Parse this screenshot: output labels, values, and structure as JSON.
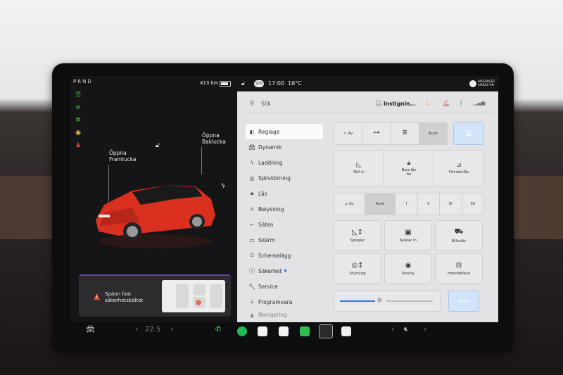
{
  "left": {
    "gear": "PRND",
    "range": "413 km",
    "callout_front": {
      "line1": "Öppna",
      "line2": "Framlucka"
    },
    "callout_rear": {
      "line1": "Öppna",
      "line2": "Baklucka"
    },
    "alert": {
      "line1": "Spänn fast",
      "line2": "säkerhetsbältet"
    }
  },
  "topbar": {
    "time": "17:00",
    "temp": "16°C",
    "sos": "SOS",
    "passenger_airbag_1": "PASSENGER",
    "passenger_airbag_2": "AIRBAG ON"
  },
  "search": {
    "label": "Sök",
    "profile": "Instignin..."
  },
  "menu": [
    {
      "label": "Reglage",
      "icon": "toggle-icon"
    },
    {
      "label": "Dynamik",
      "icon": "car-icon"
    },
    {
      "label": "Laddning",
      "icon": "bolt-icon"
    },
    {
      "label": "Självkörning",
      "icon": "steering-wheel-icon"
    },
    {
      "label": "Lås",
      "icon": "lock-icon"
    },
    {
      "label": "Belysning",
      "icon": "sun-icon"
    },
    {
      "label": "Säten",
      "icon": "seat-icon"
    },
    {
      "label": "Skärm",
      "icon": "screen-icon"
    },
    {
      "label": "Schemalägg",
      "icon": "schedule-icon"
    },
    {
      "label": "Säkerhet",
      "icon": "info-icon"
    },
    {
      "label": "Service",
      "icon": "wrench-icon"
    },
    {
      "label": "Programvara",
      "icon": "download-icon"
    },
    {
      "label": "Navigering",
      "icon": "navigation-icon"
    }
  ],
  "lights": {
    "off": "Av",
    "auto": "Auto"
  },
  "locks": {
    "fold": "Fäll in",
    "child_lock_1": "Barnlås",
    "child_lock_2": "Av",
    "windows": "Fönsterlås"
  },
  "wipers": {
    "off": "Av",
    "auto": "Auto",
    "s1": "I",
    "s2": "II",
    "s3": "III",
    "s4": "IIII"
  },
  "grid": [
    {
      "label": "Speglar",
      "icon": "mirror-icon"
    },
    {
      "label": "Spelar in",
      "icon": "dashcam-icon"
    },
    {
      "label": "Biltvätt",
      "icon": "car-wash-icon"
    },
    {
      "label": "Styrning",
      "icon": "steering-icon"
    },
    {
      "label": "Sentry",
      "icon": "sentry-icon"
    },
    {
      "label": "Handskfack",
      "icon": "glovebox-icon"
    }
  ],
  "brightness": {
    "auto": "Auto"
  },
  "dock": {
    "temp": "22.5"
  },
  "colors": {
    "accent_blue": "#d2e4fa",
    "car_red": "#d9301f",
    "alert_purple": "#6b3fb3"
  }
}
